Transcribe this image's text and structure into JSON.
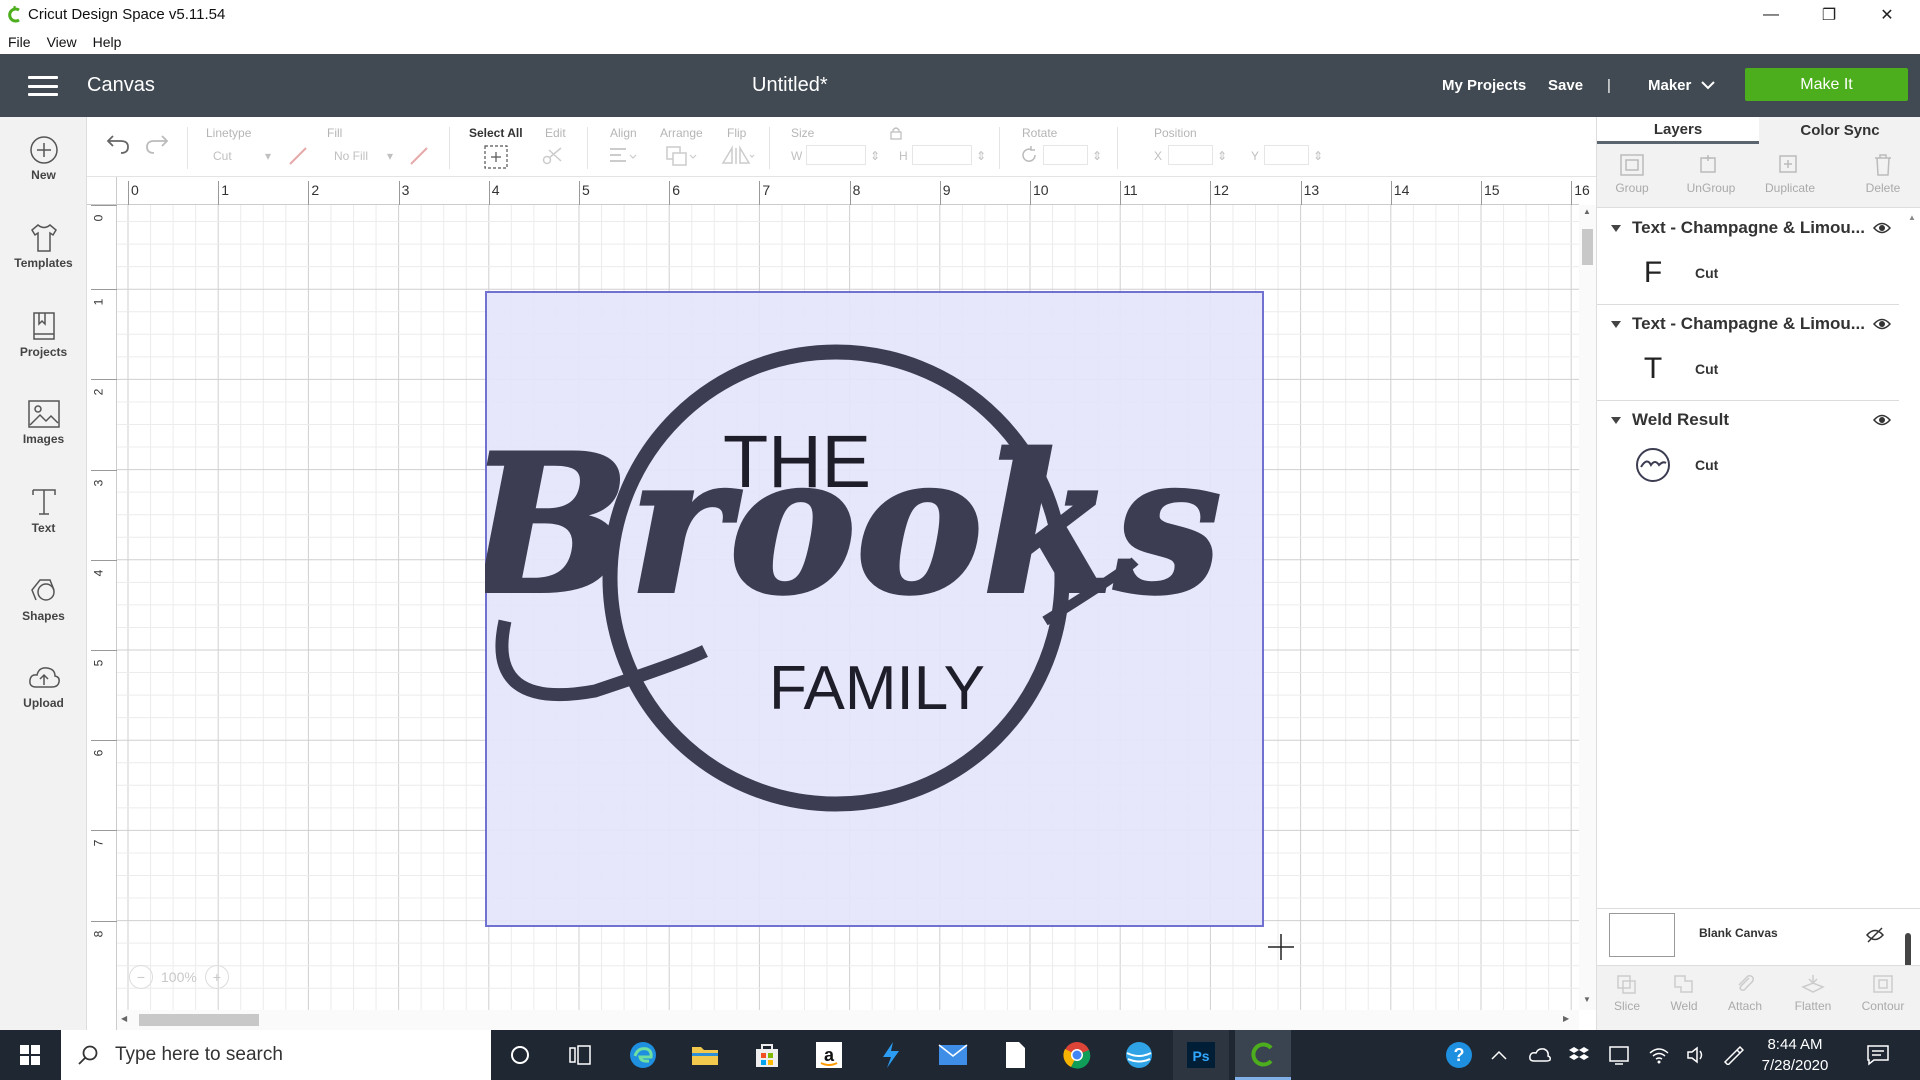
{
  "window": {
    "title": "Cricut Design Space  v5.11.54"
  },
  "menu": {
    "items": [
      "File",
      "View",
      "Help"
    ]
  },
  "header": {
    "section": "Canvas",
    "doc_title": "Untitled*",
    "my_projects": "My Projects",
    "save": "Save",
    "separator": "|",
    "machine": "Maker",
    "make_it": "Make It"
  },
  "sidebar": {
    "new": "New",
    "templates": "Templates",
    "projects": "Projects",
    "images": "Images",
    "text": "Text",
    "shapes": "Shapes",
    "upload": "Upload"
  },
  "toolbar": {
    "linetype_label": "Linetype",
    "linetype_value": "Cut",
    "fill_label": "Fill",
    "fill_value": "No Fill",
    "select_all": "Select All",
    "edit": "Edit",
    "align": "Align",
    "arrange": "Arrange",
    "flip": "Flip",
    "size": "Size",
    "size_w": "W",
    "size_h": "H",
    "rotate": "Rotate",
    "position": "Position",
    "pos_x": "X",
    "pos_y": "Y"
  },
  "ruler": {
    "h_ticks": [
      "0",
      "1",
      "2",
      "3",
      "4",
      "5",
      "6",
      "7",
      "8",
      "9",
      "10",
      "11",
      "12",
      "13",
      "14",
      "15",
      "16"
    ],
    "v_ticks": [
      "0",
      "1",
      "2",
      "3",
      "4",
      "5",
      "6",
      "7",
      "8"
    ]
  },
  "design": {
    "word_top": "THE",
    "word_script": "Brooks",
    "word_bottom": "FAMILY"
  },
  "zoom": {
    "level": "100%",
    "minus": "−",
    "plus": "+"
  },
  "panel": {
    "tab_layers": "Layers",
    "tab_color_sync": "Color Sync",
    "group": "Group",
    "ungroup": "UnGroup",
    "duplicate": "Duplicate",
    "delete": "Delete",
    "layers": [
      {
        "name": "Text - Champagne & Limou...",
        "thumb": "F",
        "op": "Cut"
      },
      {
        "name": "Text - Champagne & Limou...",
        "thumb": "T",
        "op": "Cut"
      },
      {
        "name": "Weld Result",
        "thumb": "",
        "op": "Cut"
      }
    ],
    "blank_canvas": "Blank Canvas",
    "slice": "Slice",
    "weld": "Weld",
    "attach": "Attach",
    "flatten": "Flatten",
    "contour": "Contour"
  },
  "taskbar": {
    "search_placeholder": "Type here to search",
    "time": "8:44 AM",
    "date": "7/28/2020"
  },
  "colors": {
    "header_bg": "#414a52",
    "make_it_green": "#4cae1c",
    "selection_fill": "#e6e6fb",
    "selection_border": "#6a6ad0",
    "design_ink": "#3c3d52",
    "taskbar_bg": "#1f2733"
  }
}
